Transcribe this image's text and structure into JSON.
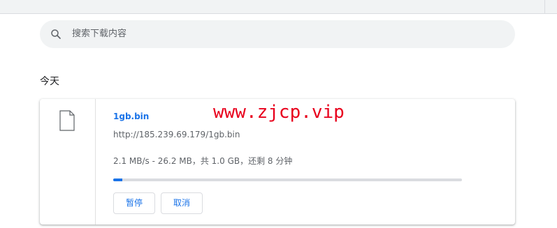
{
  "search": {
    "placeholder": "搜索下载内容",
    "icon": "search-icon"
  },
  "section": {
    "title": "今天"
  },
  "download": {
    "file_name": "1gb.bin",
    "url": "http://185.239.69.179/1gb.bin",
    "status": "2.1 MB/s - 26.2 MB，共 1.0 GB，还剩 8 分钟",
    "progress_percent": 2.6,
    "file_icon": "file-icon",
    "buttons": {
      "pause": "暂停",
      "cancel": "取消"
    }
  },
  "watermark": {
    "text": "www.zjcp.vip"
  },
  "colors": {
    "accent": "#1a73e8",
    "watermark": "#e8001c",
    "search_bg": "#f1f3f4"
  }
}
